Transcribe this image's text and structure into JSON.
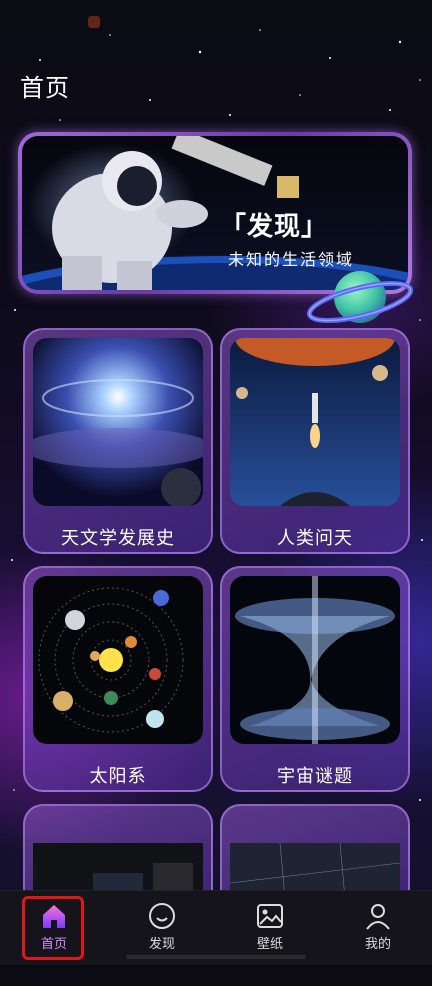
{
  "page_title": "首页",
  "banner": {
    "title": "「发现」",
    "subtitle": "未知的生活领域"
  },
  "cards": [
    {
      "label": "天文学发展史"
    },
    {
      "label": "人类问天"
    },
    {
      "label": "太阳系"
    },
    {
      "label": "宇宙谜题"
    },
    {
      "label": ""
    },
    {
      "label": ""
    }
  ],
  "nav": {
    "items": [
      {
        "label": "首页",
        "icon": "home-icon",
        "active": true
      },
      {
        "label": "发现",
        "icon": "smile-face-icon",
        "active": false
      },
      {
        "label": "壁纸",
        "icon": "image-icon",
        "active": false
      },
      {
        "label": "我的",
        "icon": "person-icon",
        "active": false
      }
    ]
  },
  "colors": {
    "accent": "#d48bff",
    "highlight_border": "#e0161b"
  }
}
